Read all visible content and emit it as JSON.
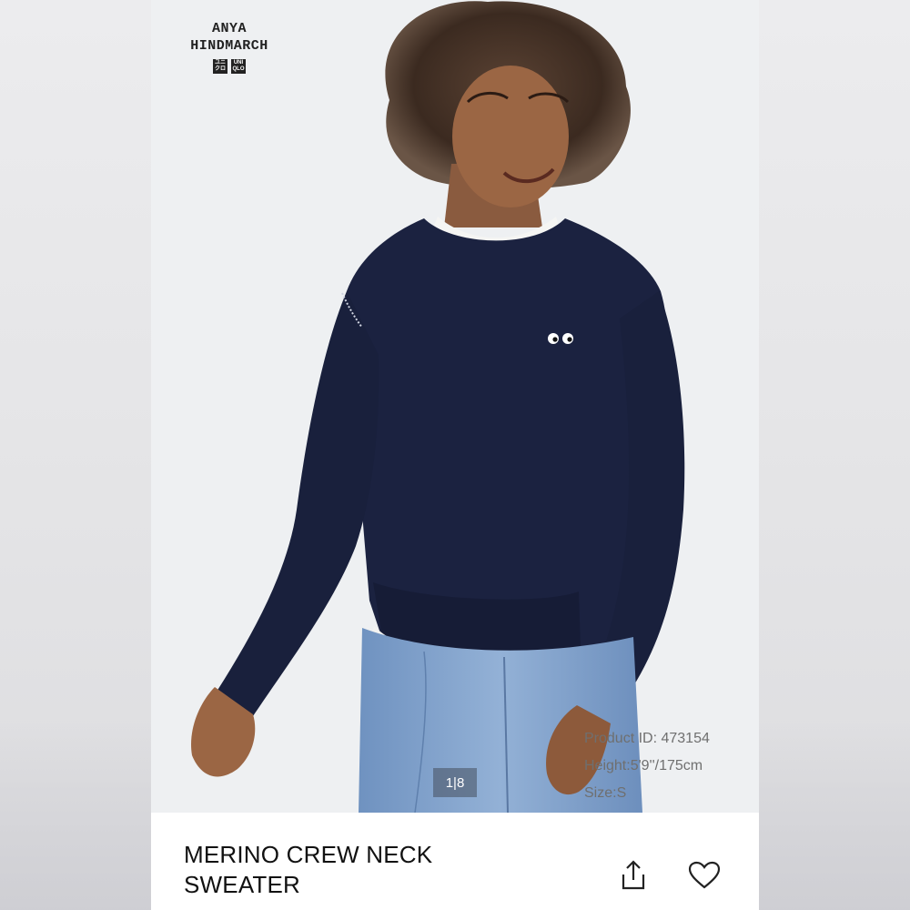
{
  "brand": {
    "collab_name": "ANYA\nHINDMARCH",
    "logo_1_text": "ユニ\nクロ",
    "logo_2_text": "UNI\nQLO"
  },
  "gallery": {
    "current_index": 1,
    "total": 8,
    "counter_text": "1|8"
  },
  "model_info": {
    "product_id": "Product ID: 473154",
    "height": "Height:5'9''/175cm",
    "size": "Size:S"
  },
  "product": {
    "title": "MERINO CREW NECK SWEATER"
  },
  "actions": {
    "share_icon": "share-icon",
    "favorite_icon": "heart-icon"
  },
  "colors": {
    "sweater": "#1b2240",
    "jeans": "#7e9fc9",
    "background": "#eef0f2"
  }
}
